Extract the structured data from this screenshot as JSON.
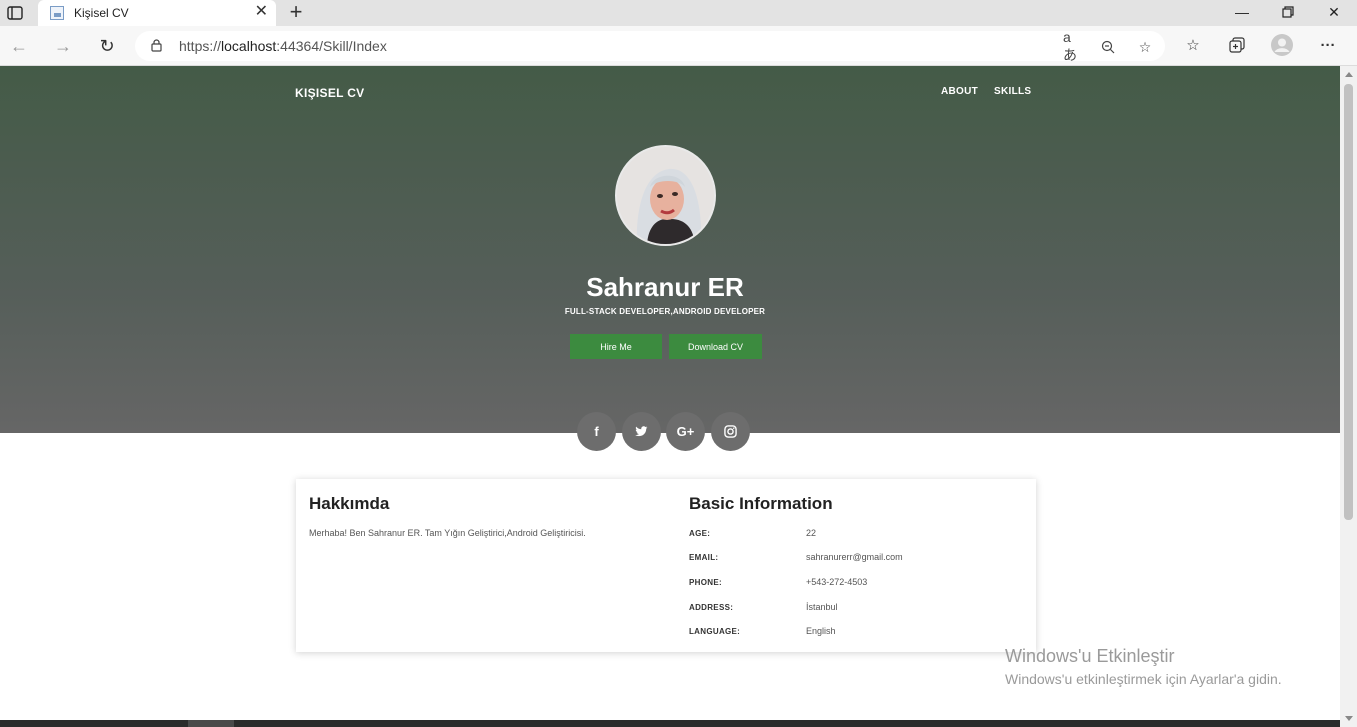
{
  "browser": {
    "tab_title": "Kişisel CV",
    "url_prefix": "https://",
    "url_host": "localhost",
    "url_path": ":44364/Skill/Index",
    "read_aloud_glyph": "aあ"
  },
  "navbar": {
    "brand": "KIŞISEL CV",
    "links": [
      "ABOUT",
      "SKILLS"
    ]
  },
  "hero": {
    "name": "Sahranur ER",
    "subtitle": "FULL-STACK DEVELOPER,ANDROID DEVELOPER",
    "hire_label": "Hire Me",
    "download_label": "Download CV",
    "social_icons": [
      "facebook-icon",
      "twitter-icon",
      "google-plus-icon",
      "instagram-icon"
    ],
    "social_glyphs": [
      "f",
      "🐦",
      "G+",
      "◎"
    ]
  },
  "about": {
    "title": "Hakkımda",
    "text": "Merhaba! Ben Sahranur ER. Tam Yığın Geliştirici,Android Geliştiricisi."
  },
  "basic_info": {
    "title": "Basic Information",
    "rows": [
      {
        "label": "AGE:",
        "value": "22"
      },
      {
        "label": "EMAIL:",
        "value": "sahranurerr@gmail.com"
      },
      {
        "label": "PHONE:",
        "value": "+543-272-4503"
      },
      {
        "label": "ADDRESS:",
        "value": "İstanbul"
      },
      {
        "label": "LANGUAGE:",
        "value": "English"
      }
    ]
  },
  "watermark": {
    "line1": "Windows'u Etkinleştir",
    "line2": "Windows'u etkinleştirmek için Ayarlar'a gidin."
  },
  "colors": {
    "accent_button": "#3c8b3f",
    "hero_top": "#445b47",
    "hero_bottom": "#666666"
  }
}
